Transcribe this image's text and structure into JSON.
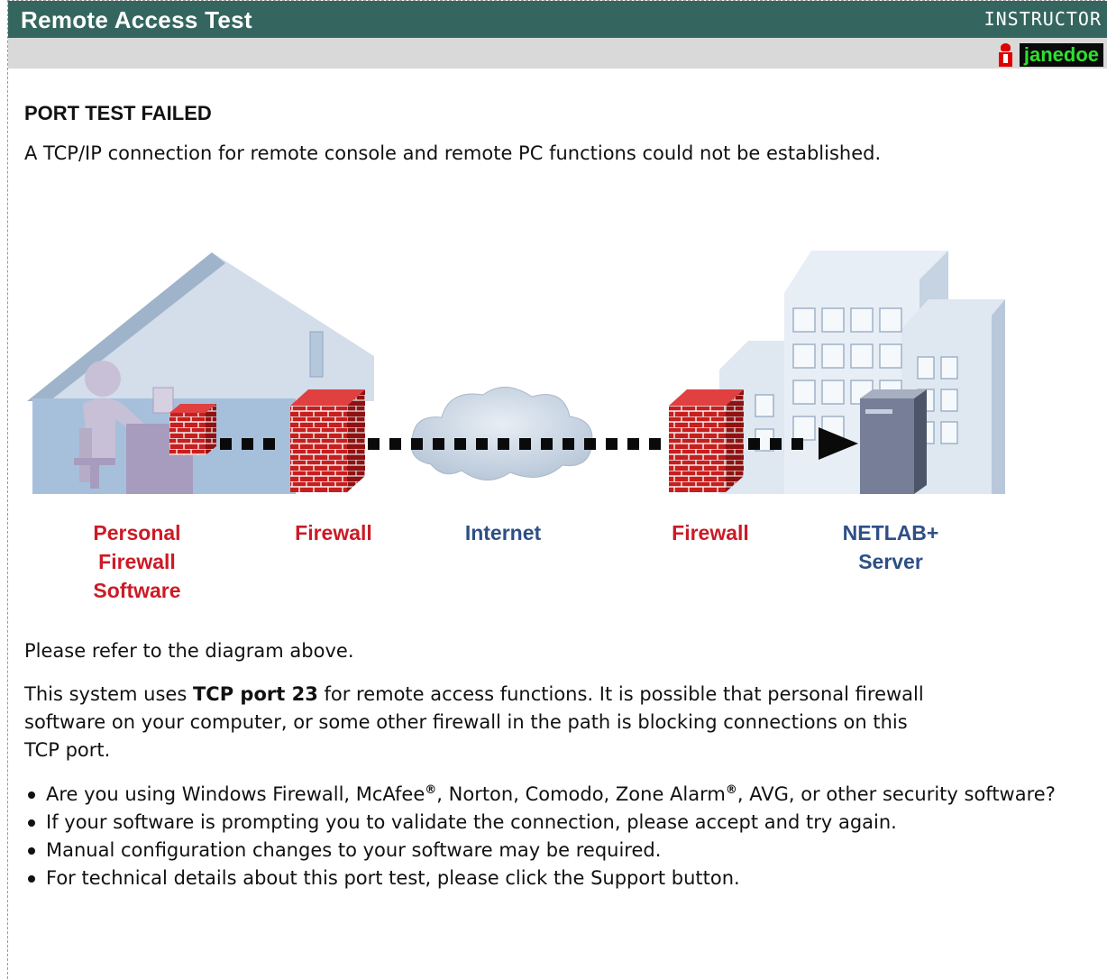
{
  "header": {
    "title": "Remote Access Test",
    "role": "INSTRUCTOR",
    "username": "janedoe"
  },
  "main": {
    "heading": "PORT TEST FAILED",
    "intro": "A TCP/IP connection for remote console and remote PC functions could not be established.",
    "diagram_labels": {
      "personal_firewall": [
        "Personal",
        "Firewall",
        "Software"
      ],
      "firewall_left": "Firewall",
      "internet": "Internet",
      "firewall_right": "Firewall",
      "server": [
        "NETLAB+",
        "Server"
      ]
    },
    "refer": "Please refer to the diagram above.",
    "port_text_before": "This system uses ",
    "port_text_bold": "TCP port 23",
    "port_text_after": " for remote access functions. It is possible that personal firewall software on your computer, or some other firewall in the path is blocking connections on this TCP port.",
    "bullets": {
      "b1_a": "Are you using Windows Firewall, McAfee",
      "b1_reg1": "®",
      "b1_b": ", Norton, Comodo, Zone Alarm",
      "b1_reg2": "®",
      "b1_c": ", AVG, or other security software?",
      "b2": "If your software is prompting you to validate the connection, please accept and try again.",
      "b3": "Manual configuration changes to your software may be required.",
      "b4": "For technical details about this port test, please click the Support button."
    }
  },
  "colors": {
    "title_bar": "#34665f",
    "user_bar": "#d9d9d9",
    "label_red": "#cc1a26",
    "label_blue": "#2e4f86",
    "username_text": "#2fe02f"
  }
}
